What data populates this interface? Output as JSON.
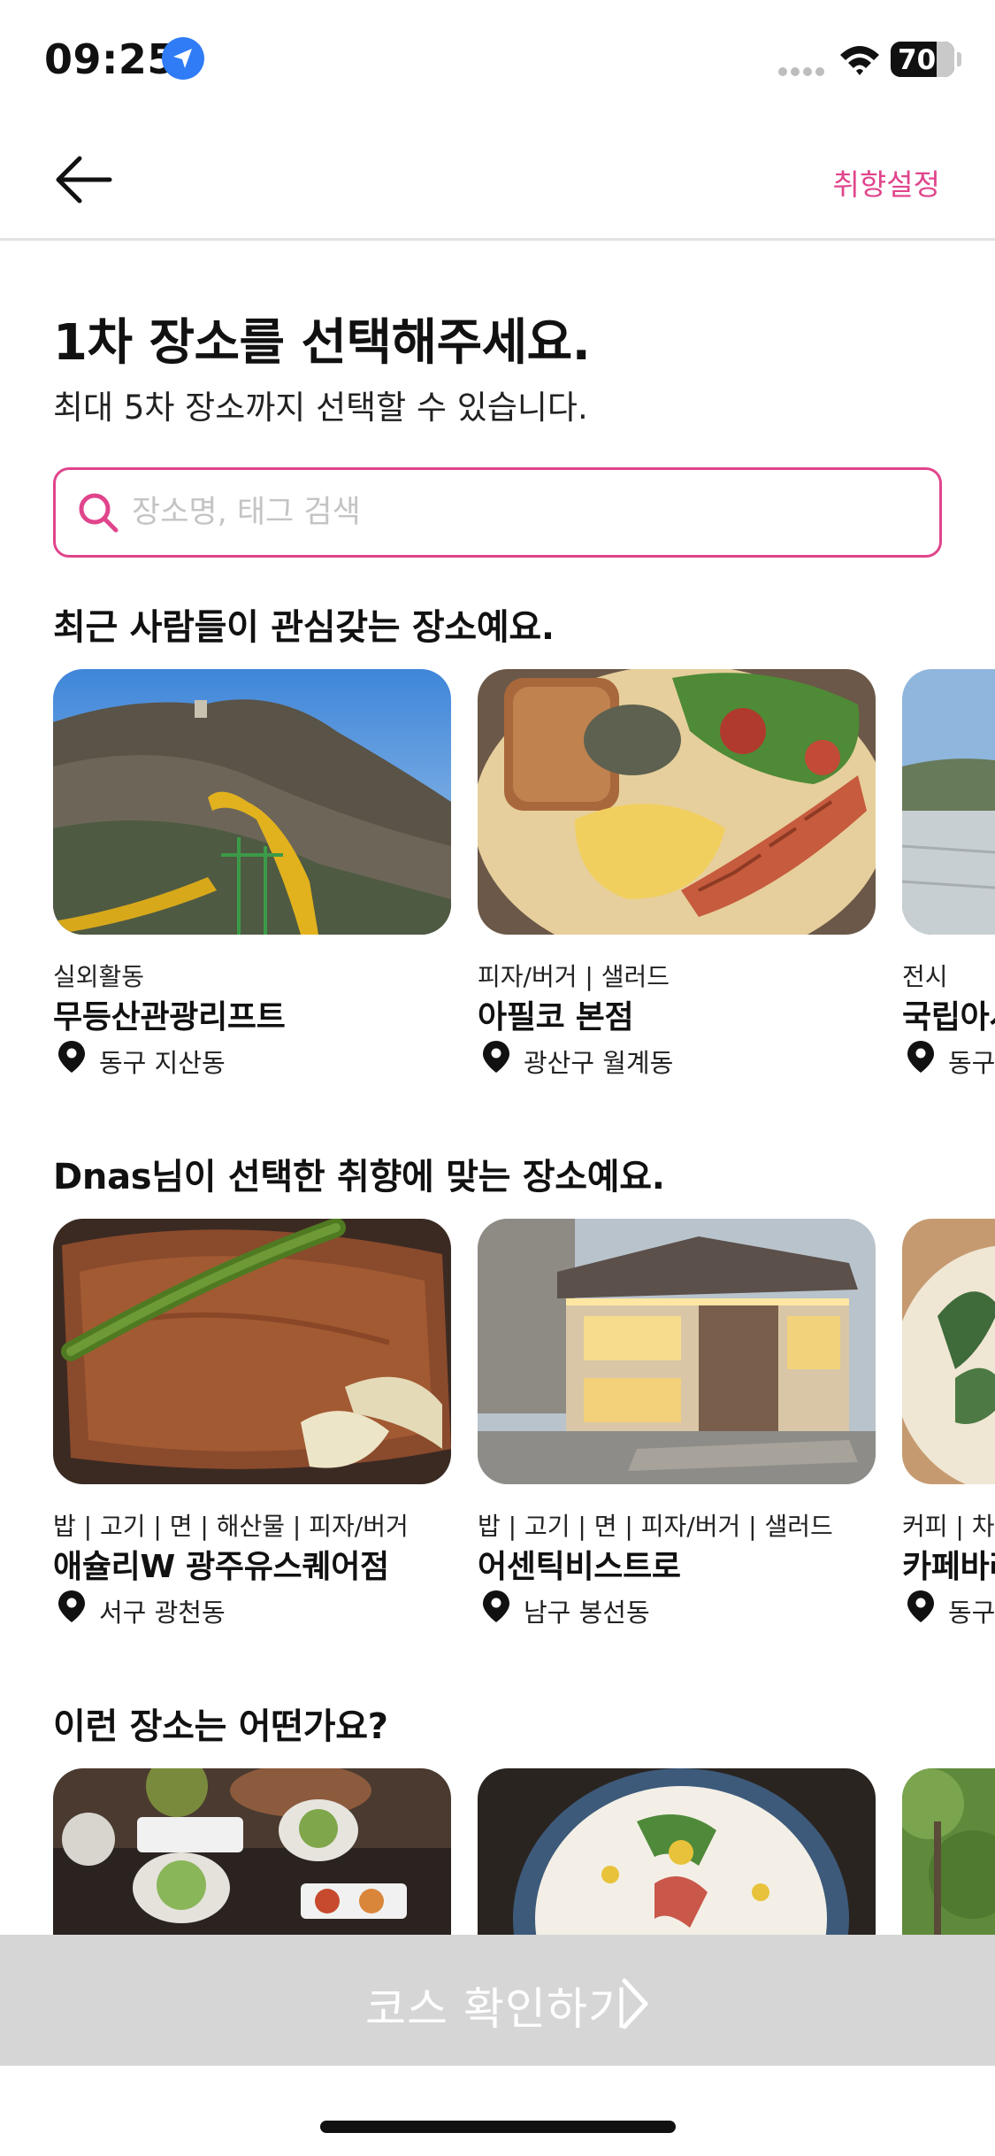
{
  "status_bar": {
    "time": "09:25",
    "battery": "70",
    "icons": [
      "location-arrow-icon",
      "signal-icon",
      "wifi-icon",
      "battery-icon"
    ]
  },
  "nav": {
    "back_icon": "arrow-left-icon",
    "preference_label": "취향설정"
  },
  "header": {
    "title": "1차 장소를 선택해주세요.",
    "subtitle": "최대 5차 장소까지 선택할 수 있습니다."
  },
  "search": {
    "placeholder": "장소명, 태그 검색",
    "value": "",
    "icon": "search-icon"
  },
  "sections": [
    {
      "title": "최근 사람들이 관심갖는 장소예요.",
      "cards": [
        {
          "category": "실외활동",
          "name": "무등산관광리프트",
          "location": "동구 지산동"
        },
        {
          "category": "피자/버거 | 샐러드",
          "name": "아필코 본점",
          "location": "광산구 월계동"
        },
        {
          "category": "전시",
          "name": "국립아시아문화전당",
          "location": "동구 광산동"
        }
      ]
    },
    {
      "title": "Dnas님이 선택한 취향에 맞는 장소예요.",
      "cards": [
        {
          "category": "밥 | 고기 | 면 | 해산물 | 피자/버거",
          "name": "애슐리W 광주유스퀘어점",
          "location": "서구 광천동"
        },
        {
          "category": "밥 | 고기 | 면 | 피자/버거 | 샐러드",
          "name": "어센틱비스트로",
          "location": "남구 봉선동"
        },
        {
          "category": "커피 | 차",
          "name": "카페바라",
          "location": "동구 동명동"
        }
      ]
    },
    {
      "title": "이런 장소는 어떤가요?",
      "cards": [
        {
          "category": "",
          "name": "",
          "location": ""
        },
        {
          "category": "",
          "name": "",
          "location": ""
        },
        {
          "category": "",
          "name": "",
          "location": ""
        }
      ]
    }
  ],
  "cta": {
    "label": "코스 확인하기",
    "icon": "chevron-right-icon"
  },
  "colors": {
    "accent": "#e0458c",
    "cta_disabled": "#d6d6d6",
    "location_blue": "#2f7cf6"
  }
}
